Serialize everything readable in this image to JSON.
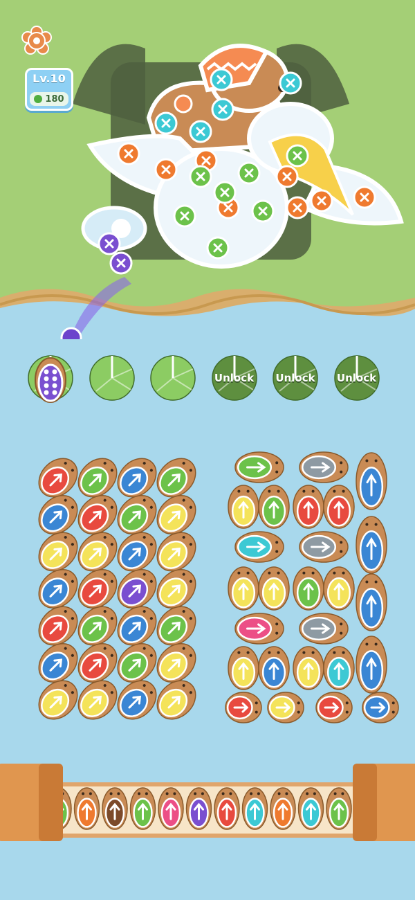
{
  "hud": {
    "settings_icon": "gear-icon",
    "level_label": "Lv.10",
    "coins": "180"
  },
  "pads": [
    {
      "state": "occupied"
    },
    {
      "state": "open"
    },
    {
      "state": "open"
    },
    {
      "state": "locked",
      "label": "Unlock"
    },
    {
      "state": "locked",
      "label": "Unlock"
    },
    {
      "state": "locked",
      "label": "Unlock"
    }
  ],
  "colors": {
    "water": "#a8d8ec",
    "grass": "#a4cf76",
    "red": "#e84a3f",
    "green": "#6cc24a",
    "blue": "#3a86d4",
    "yellow": "#f4e35a",
    "purple": "#7a4fd0",
    "cyan": "#3cc9d4",
    "pink": "#ec4f86",
    "gray": "#8e9aa3",
    "orange": "#ef7a2f",
    "brown": "#7c4a2a",
    "lily": "#8ccc63",
    "lily_locked": "#5e8f3f"
  },
  "left_grid_colors": [
    [
      "red",
      "green",
      "blue",
      "green"
    ],
    [
      "blue",
      "red",
      "green",
      "yellow"
    ],
    [
      "yellow",
      "yellow",
      "blue",
      "yellow"
    ],
    [
      "blue",
      "red",
      "purple",
      "yellow"
    ],
    [
      "red",
      "green",
      "blue",
      "green"
    ],
    [
      "blue",
      "red",
      "green",
      "yellow"
    ],
    [
      "yellow",
      "yellow",
      "blue",
      "yellow"
    ]
  ],
  "right_block": [
    {
      "type": "h",
      "color": "green"
    },
    {
      "type": "h",
      "color": "gray"
    },
    {
      "type": "v",
      "color": "blue"
    },
    {
      "type": "v",
      "color": "yellow"
    },
    {
      "type": "v",
      "color": "green"
    },
    {
      "type": "v",
      "color": "red"
    },
    {
      "type": "v",
      "color": "red"
    },
    {
      "type": "h",
      "color": "cyan"
    },
    {
      "type": "h",
      "color": "gray"
    },
    {
      "type": "v",
      "color": "yellow"
    },
    {
      "type": "v",
      "color": "yellow"
    },
    {
      "type": "v",
      "color": "green"
    },
    {
      "type": "v",
      "color": "yellow"
    },
    {
      "type": "v",
      "color": "blue"
    },
    {
      "type": "v",
      "color": "blue"
    },
    {
      "type": "h",
      "color": "pink"
    },
    {
      "type": "h",
      "color": "gray"
    },
    {
      "type": "v",
      "color": "yellow"
    },
    {
      "type": "v",
      "color": "blue"
    },
    {
      "type": "v",
      "color": "yellow"
    },
    {
      "type": "v",
      "color": "cyan"
    },
    {
      "type": "v",
      "color": "blue"
    },
    {
      "type": "h",
      "color": "red"
    },
    {
      "type": "h",
      "color": "yellow"
    },
    {
      "type": "h",
      "color": "red"
    },
    {
      "type": "h",
      "color": "blue"
    }
  ],
  "queue_colors": [
    "green",
    "orange",
    "brown",
    "green",
    "pink",
    "purple",
    "red",
    "cyan",
    "orange",
    "cyan",
    "green",
    "brown"
  ],
  "screws": {
    "cyan": 5,
    "orange": 8,
    "green": 7,
    "purple": 2
  }
}
